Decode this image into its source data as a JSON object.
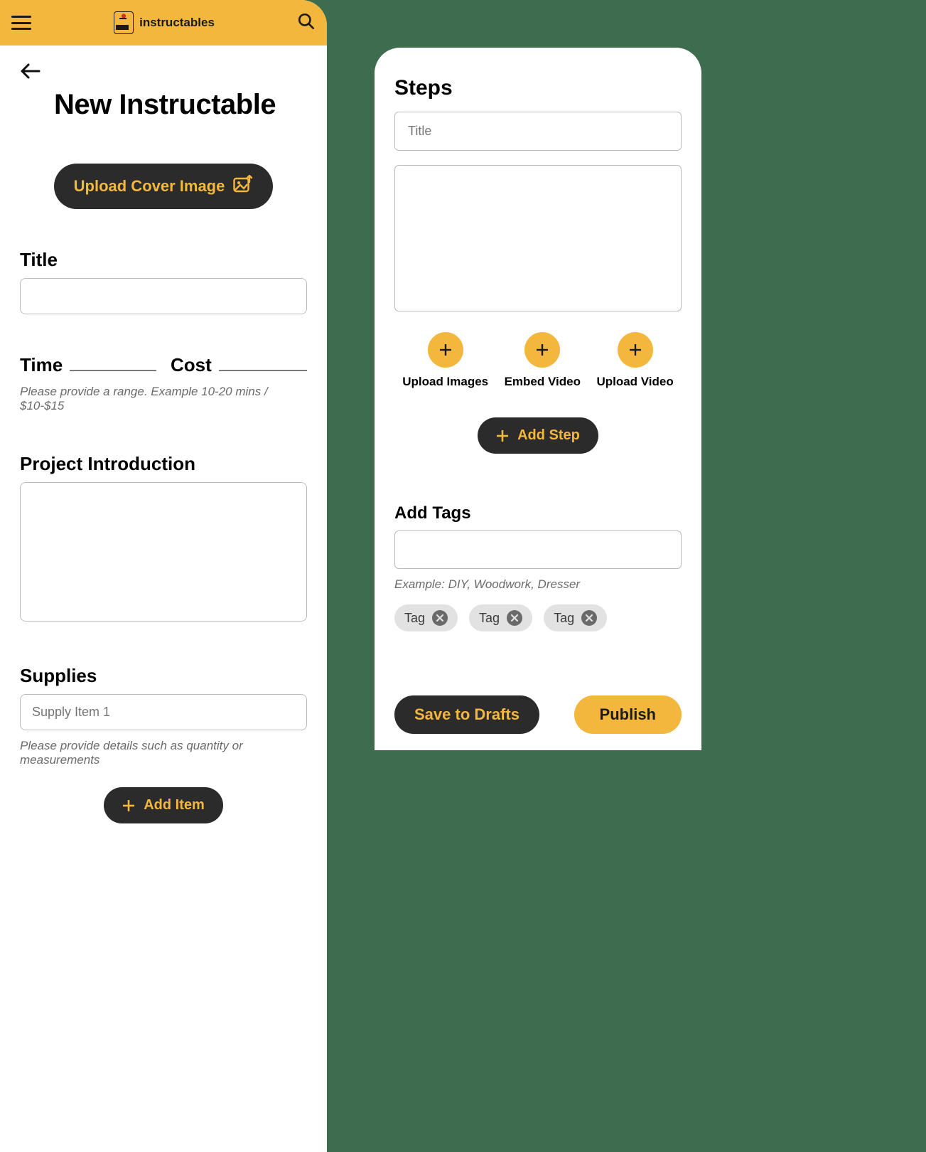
{
  "header": {
    "brand": "instructables"
  },
  "page": {
    "title": "New Instructable",
    "upload_cover_label": "Upload Cover Image",
    "title_label": "Title",
    "time_label": "Time",
    "cost_label": "Cost",
    "time_cost_hint": "Please provide a range. Example 10-20 mins / $10-$15",
    "intro_label": "Project Introduction",
    "supplies_label": "Supplies",
    "supply_placeholder": "Supply Item 1",
    "supplies_hint": "Please provide details such as quantity or measurements",
    "add_item_label": "Add Item"
  },
  "steps": {
    "heading": "Steps",
    "title_placeholder": "Title",
    "media": {
      "upload_images": "Upload Images",
      "embed_video": "Embed Video",
      "upload_video": "Upload Video"
    },
    "add_step_label": "Add Step"
  },
  "tags": {
    "heading": "Add Tags",
    "hint": "Example: DIY, Woodwork, Dresser",
    "items": [
      "Tag",
      "Tag",
      "Tag"
    ]
  },
  "actions": {
    "save_drafts": "Save to Drafts",
    "publish": "Publish"
  }
}
